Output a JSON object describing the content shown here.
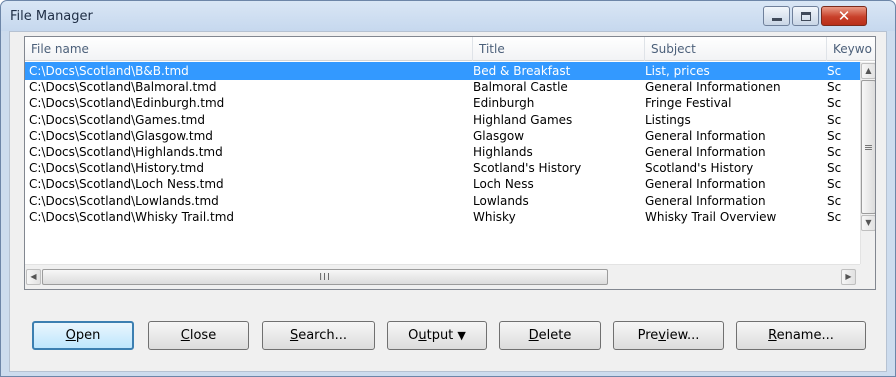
{
  "window": {
    "title": "File Manager"
  },
  "list": {
    "columns": [
      "File name",
      "Title",
      "Subject",
      "Keywords"
    ],
    "header_visible": [
      "File name",
      "Title",
      "Subject",
      "Keywo"
    ],
    "rows": [
      [
        "C:\\Docs\\Scotland\\B&B.tmd",
        "Bed & Breakfast",
        "List, prices",
        "Sc"
      ],
      [
        "C:\\Docs\\Scotland\\Balmoral.tmd",
        "Balmoral Castle",
        "General Informationen",
        "Sc"
      ],
      [
        "C:\\Docs\\Scotland\\Edinburgh.tmd",
        "Edinburgh",
        "Fringe Festival",
        "Sc"
      ],
      [
        "C:\\Docs\\Scotland\\Games.tmd",
        "Highland Games",
        "Listings",
        "Sc"
      ],
      [
        "C:\\Docs\\Scotland\\Glasgow.tmd",
        "Glasgow",
        "General Information",
        "Sc"
      ],
      [
        "C:\\Docs\\Scotland\\Highlands.tmd",
        "Highlands",
        "General Information",
        "Sc"
      ],
      [
        "C:\\Docs\\Scotland\\History.tmd",
        "Scotland's History",
        "Scotland's History",
        "Sc"
      ],
      [
        "C:\\Docs\\Scotland\\Loch Ness.tmd",
        "Loch Ness",
        "General Information",
        "Sc"
      ],
      [
        "C:\\Docs\\Scotland\\Lowlands.tmd",
        "Lowlands",
        "General Information",
        "Sc"
      ],
      [
        "C:\\Docs\\Scotland\\Whisky Trail.tmd",
        "Whisky",
        "Whisky Trail Overview",
        "Sc"
      ]
    ],
    "selected_index": 0,
    "hscroll_grip": "III"
  },
  "buttons": {
    "open": {
      "pre": "",
      "mnemonic": "O",
      "post": "pen"
    },
    "close": {
      "pre": "",
      "mnemonic": "C",
      "post": "lose"
    },
    "search": {
      "pre": "",
      "mnemonic": "S",
      "post": "earch..."
    },
    "output": {
      "pre": "O",
      "mnemonic": "u",
      "post": "tput",
      "arrow": "▼"
    },
    "delete": {
      "pre": "",
      "mnemonic": "D",
      "post": "elete"
    },
    "preview": {
      "pre": "Pre",
      "mnemonic": "v",
      "post": "iew..."
    },
    "rename": {
      "pre": "",
      "mnemonic": "R",
      "post": "ename..."
    }
  },
  "colors": {
    "selection": "#3399ff",
    "close_button": "#c8402a",
    "frame": "#cddcee"
  }
}
